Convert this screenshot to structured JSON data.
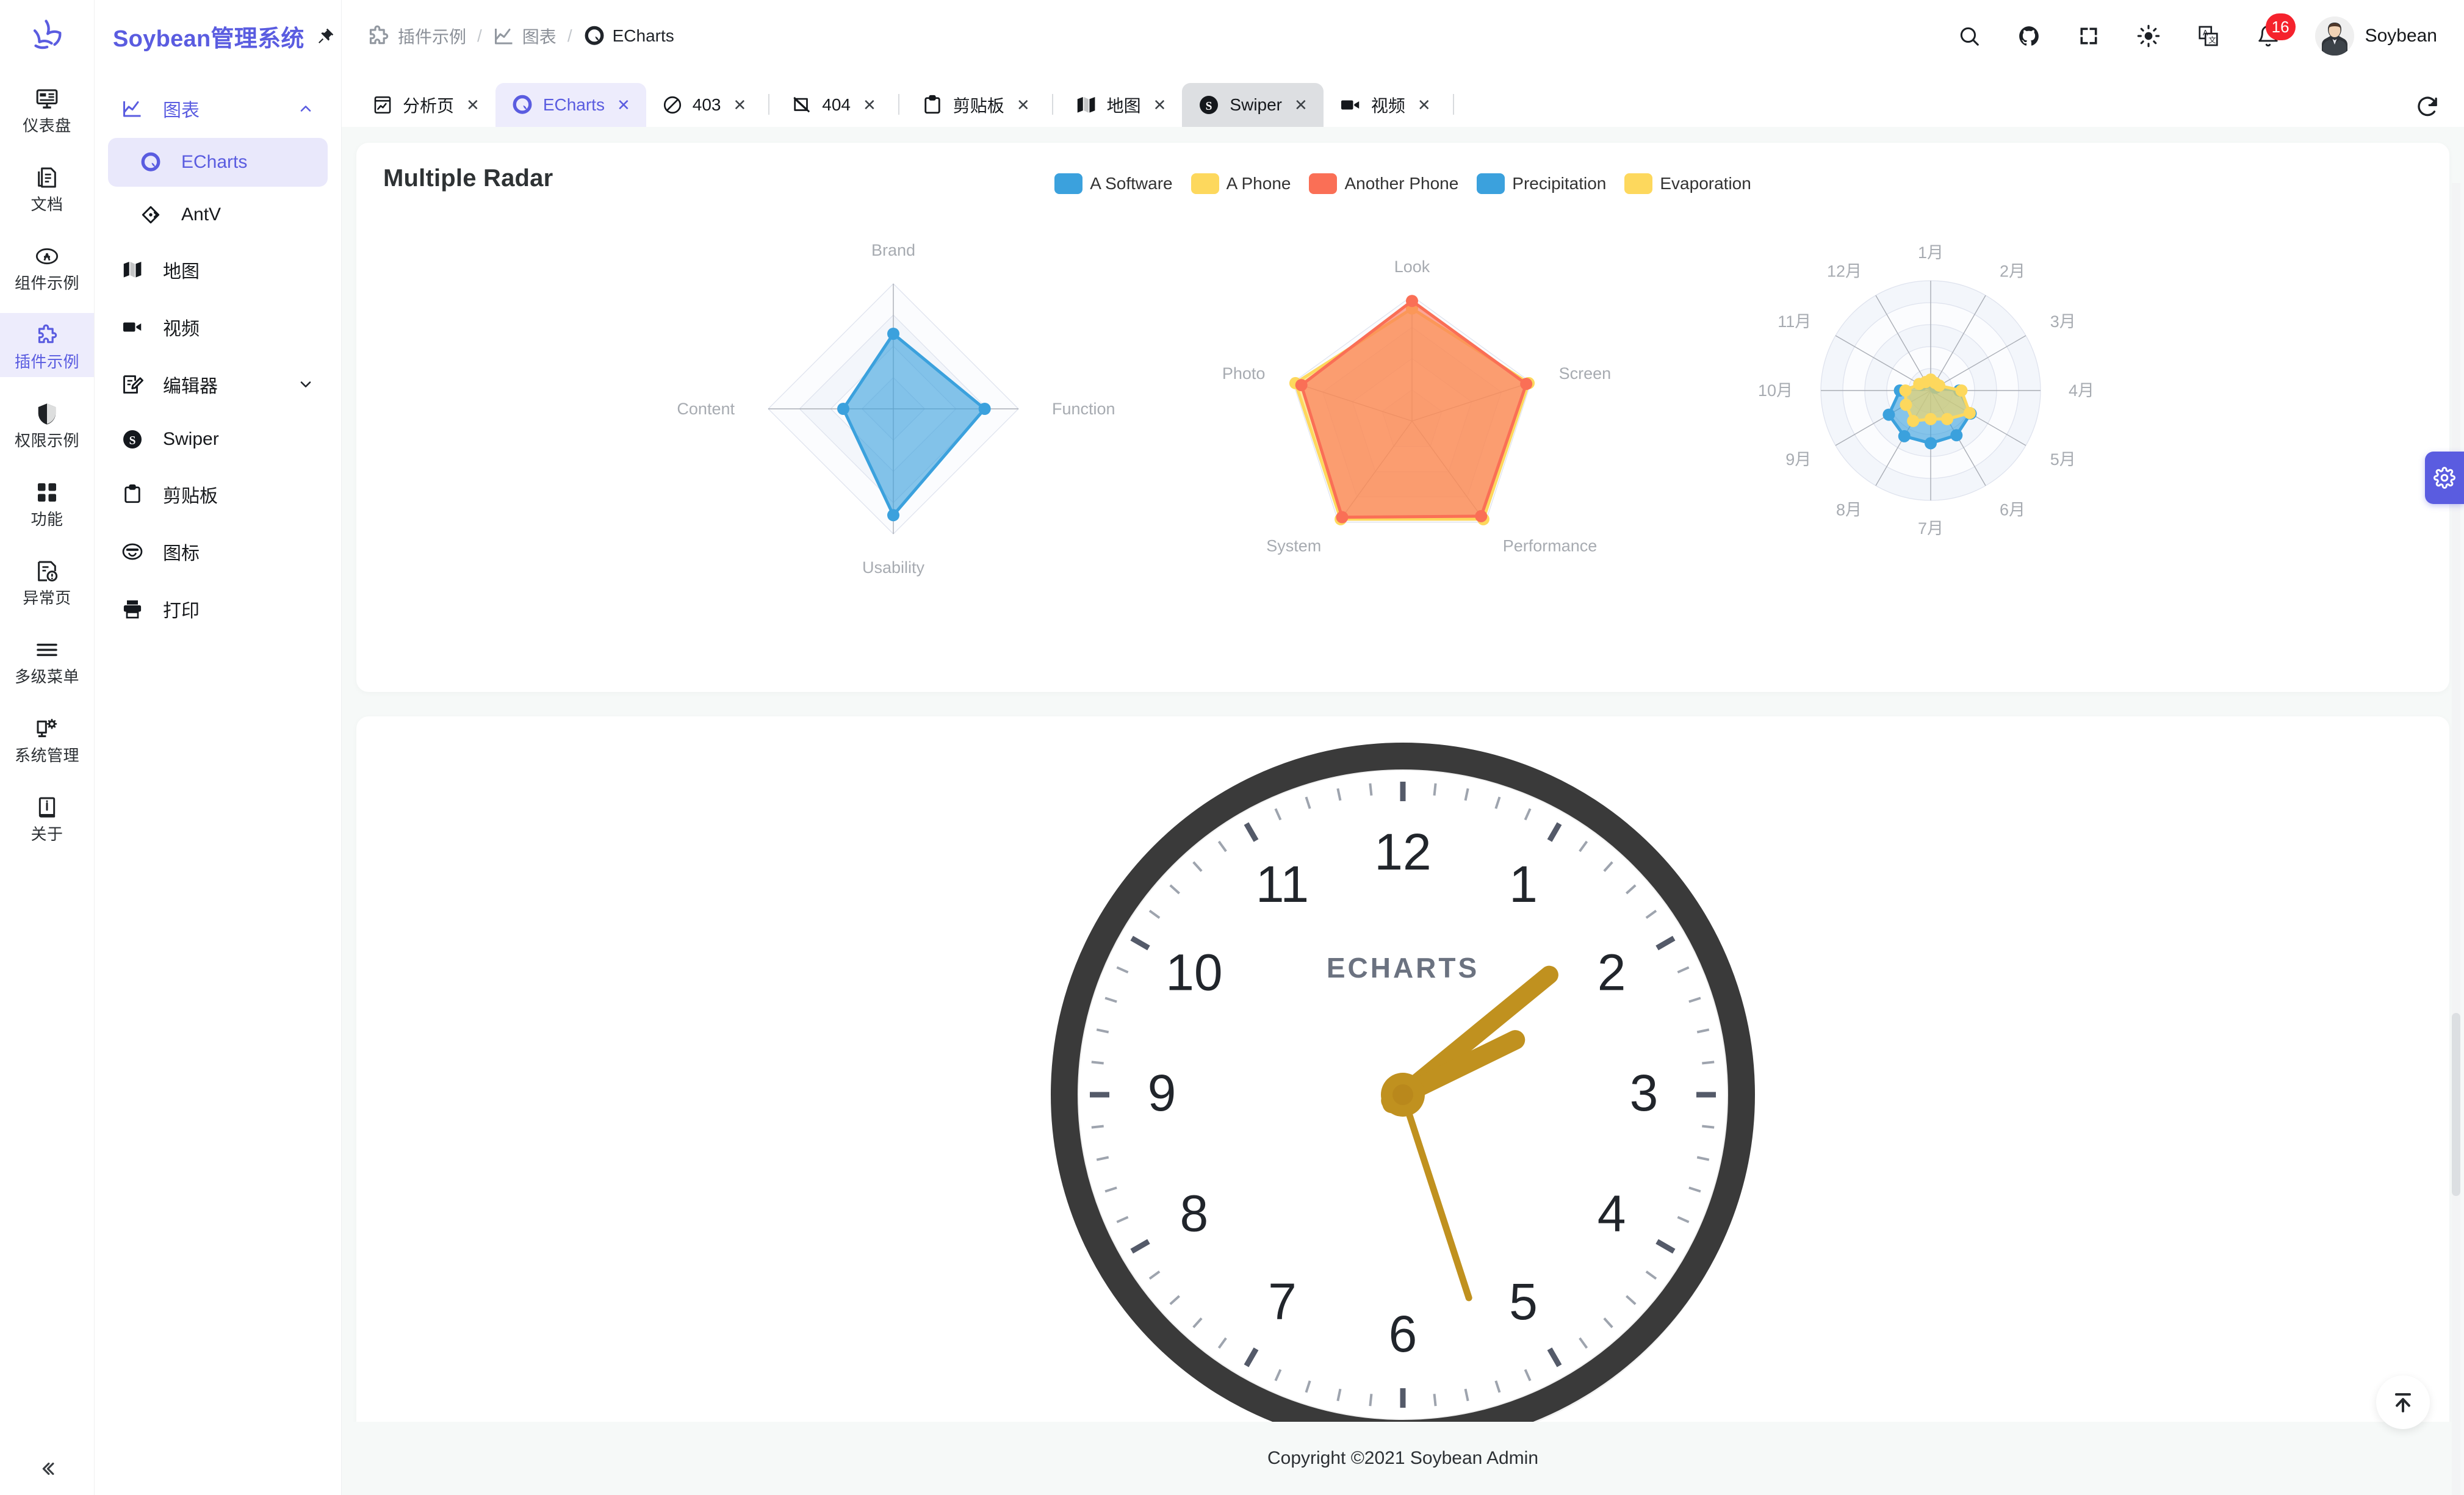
{
  "app": {
    "title": "Soybean管理系统",
    "user_name": "Soybean",
    "notification_count": "16",
    "footer": "Copyright ©2021 Soybean Admin"
  },
  "rail": {
    "items": [
      {
        "label": "仪表盘",
        "icon": "dashboard-icon",
        "active": false
      },
      {
        "label": "文档",
        "icon": "document-icon",
        "active": false
      },
      {
        "label": "组件示例",
        "icon": "component-icon",
        "active": false
      },
      {
        "label": "插件示例",
        "icon": "plugin-icon",
        "active": true
      },
      {
        "label": "权限示例",
        "icon": "shield-icon",
        "active": false
      },
      {
        "label": "功能",
        "icon": "grid-icon",
        "active": false
      },
      {
        "label": "异常页",
        "icon": "exception-icon",
        "active": false
      },
      {
        "label": "多级菜单",
        "icon": "menu-lines-icon",
        "active": false
      },
      {
        "label": "系统管理",
        "icon": "system-gear-icon",
        "active": false
      },
      {
        "label": "关于",
        "icon": "info-icon",
        "active": false
      }
    ],
    "collapse_label": "«"
  },
  "submenu": {
    "group": {
      "label": "图表",
      "icon": "chart-line-icon"
    },
    "items": [
      {
        "label": "ECharts",
        "icon": "echarts-icon",
        "active": true,
        "child": true
      },
      {
        "label": "AntV",
        "icon": "antv-icon",
        "active": false,
        "child": true
      },
      {
        "label": "地图",
        "icon": "map-icon",
        "active": false,
        "child": false
      },
      {
        "label": "视频",
        "icon": "video-icon",
        "active": false,
        "child": false
      },
      {
        "label": "编辑器",
        "icon": "editor-icon",
        "active": false,
        "child": false,
        "expandable": true
      },
      {
        "label": "Swiper",
        "icon": "swiper-icon",
        "active": false,
        "child": false
      },
      {
        "label": "剪贴板",
        "icon": "clipboard-icon",
        "active": false,
        "child": false
      },
      {
        "label": "图标",
        "icon": "emoji-icon",
        "active": false,
        "child": false
      },
      {
        "label": "打印",
        "icon": "print-icon",
        "active": false,
        "child": false
      }
    ]
  },
  "breadcrumb": [
    {
      "label": "插件示例",
      "icon": "plugin-icon"
    },
    {
      "label": "图表",
      "icon": "chart-line-icon"
    },
    {
      "label": "ECharts",
      "icon": "echarts-icon"
    }
  ],
  "topbar": {
    "icons": [
      "search-icon",
      "github-icon",
      "fullscreen-icon",
      "theme-sun-icon",
      "language-icon",
      "bell-icon"
    ]
  },
  "tabs": [
    {
      "label": "分析页",
      "icon": "analysis-icon",
      "state": "normal",
      "divider_after": false
    },
    {
      "label": "ECharts",
      "icon": "echarts-icon",
      "state": "active-primary",
      "divider_after": false
    },
    {
      "label": "403",
      "icon": "forbidden-icon",
      "state": "normal",
      "divider_after": true
    },
    {
      "label": "404",
      "icon": "notfound-icon",
      "state": "normal",
      "divider_after": true
    },
    {
      "label": "剪贴板",
      "icon": "clipboard-icon",
      "state": "normal",
      "divider_after": true
    },
    {
      "label": "地图",
      "icon": "map-icon",
      "state": "normal",
      "divider_after": false
    },
    {
      "label": "Swiper",
      "icon": "swiper-icon",
      "state": "active-grey",
      "divider_after": false
    },
    {
      "label": "视频",
      "icon": "video-icon",
      "state": "normal",
      "divider_after": true
    }
  ],
  "tab_close_glyph": "✕",
  "colors": {
    "primary": "#5a5ce0",
    "blue": "#3ba1dd",
    "yellow": "#fdd85d",
    "red": "#fa6f56",
    "badge_red": "#f5222d",
    "clock_frame": "#3a3a3a",
    "clock_hand": "#c0911f"
  },
  "chart_data": [
    {
      "type": "radar",
      "title": "Multiple Radar",
      "legend": [
        {
          "name": "A Software",
          "color": "#3ba1dd"
        },
        {
          "name": "A Phone",
          "color": "#fdd85d"
        },
        {
          "name": "Another Phone",
          "color": "#fa6f56"
        },
        {
          "name": "Precipitation",
          "color": "#3ba1dd"
        },
        {
          "name": "Evaporation",
          "color": "#fdd85d"
        }
      ],
      "legend_position": "top-center",
      "radars": [
        {
          "name": "radar-1",
          "shape": "polygon",
          "indicators": [
            {
              "name": "Brand",
              "max": 100
            },
            {
              "name": "Function",
              "max": 100
            },
            {
              "name": "Usability",
              "max": 100
            },
            {
              "name": "Content",
              "max": 100
            }
          ],
          "series": [
            {
              "name": "A Software",
              "color": "#3ba1dd",
              "values": [
                60,
                73,
                85,
                40
              ]
            }
          ]
        },
        {
          "name": "radar-2",
          "shape": "polygon",
          "indicators": [
            {
              "name": "Look",
              "max": 100
            },
            {
              "name": "Screen",
              "max": 100
            },
            {
              "name": "Performance",
              "max": 100
            },
            {
              "name": "System",
              "max": 100
            },
            {
              "name": "Photo",
              "max": 100
            }
          ],
          "series": [
            {
              "name": "A Phone",
              "color": "#fdd85d",
              "values": [
                90,
                98,
                97,
                97,
                98
              ]
            },
            {
              "name": "Another Phone",
              "color": "#fa6f56",
              "values": [
                96,
                96,
                94,
                95,
                93
              ]
            }
          ]
        },
        {
          "name": "radar-3",
          "shape": "circle",
          "indicators": [
            {
              "name": "1月",
              "max": 100
            },
            {
              "name": "2月",
              "max": 100
            },
            {
              "name": "3月",
              "max": 100
            },
            {
              "name": "4月",
              "max": 100
            },
            {
              "name": "5月",
              "max": 100
            },
            {
              "name": "6月",
              "max": 100
            },
            {
              "name": "7月",
              "max": 100
            },
            {
              "name": "8月",
              "max": 100
            },
            {
              "name": "9月",
              "max": 100
            },
            {
              "name": "10月",
              "max": 100
            },
            {
              "name": "11月",
              "max": 100
            },
            {
              "name": "12月",
              "max": 100
            }
          ],
          "series": [
            {
              "name": "Precipitation",
              "color": "#3ba1dd",
              "values": [
                8,
                6,
                5,
                26,
                42,
                47,
                48,
                48,
                44,
                28,
                10,
                8
              ]
            },
            {
              "name": "Evaporation",
              "color": "#fdd85d",
              "values": [
                10,
                8,
                9,
                28,
                41,
                30,
                26,
                32,
                26,
                23,
                12,
                9
              ]
            }
          ]
        }
      ]
    },
    {
      "type": "gauge-clock",
      "brand": "ECHARTS",
      "hour_numbers": [
        "12",
        "1",
        "2",
        "3",
        "4",
        "5",
        "6",
        "7",
        "8",
        "9",
        "10",
        "11"
      ],
      "time": {
        "hour": 2,
        "minute": 8,
        "second": 27
      }
    }
  ],
  "floating": {
    "settings_icon": "gear-icon",
    "back_to_top_icon": "arrow-to-top-icon"
  }
}
